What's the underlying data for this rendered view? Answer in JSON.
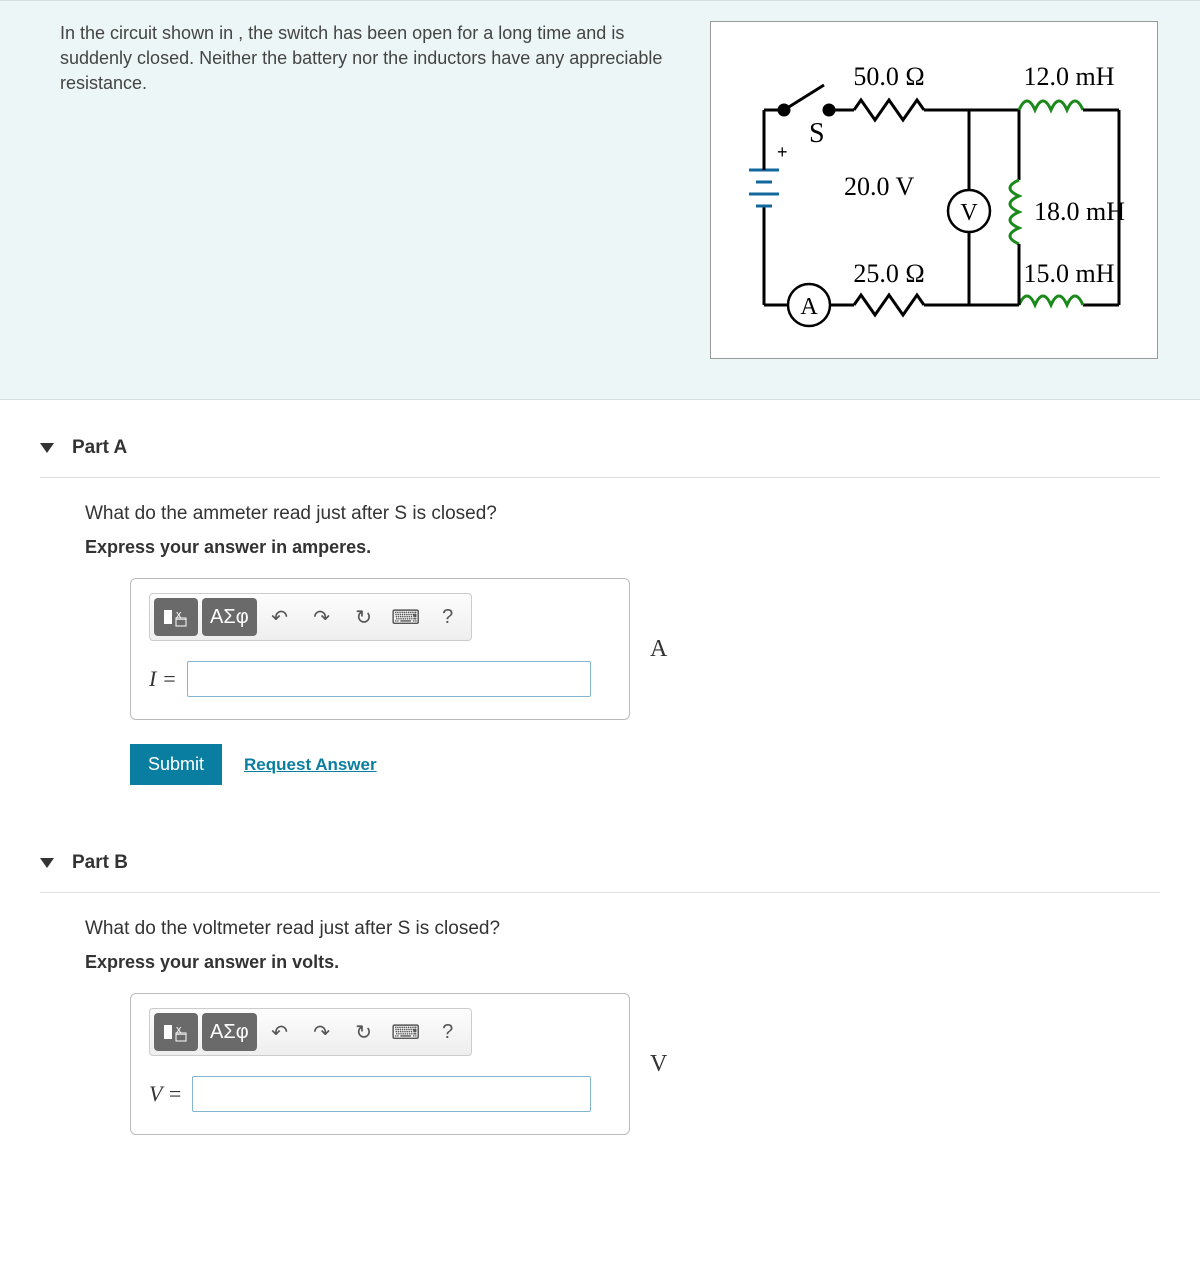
{
  "intro": "In the circuit shown in , the switch has been open for a long time and is suddenly closed. Neither the battery nor the inductors have any appreciable resistance.",
  "circuit": {
    "R1": "50.0 Ω",
    "L1": "12.0 mH",
    "S": "S",
    "Vsrc": "20.0 V",
    "Vmeter": "V",
    "L2": "18.0 mH",
    "R2": "25.0 Ω",
    "L3": "15.0 mH",
    "Ammeter": "A"
  },
  "partA": {
    "title": "Part A",
    "question": "What do the ammeter read just after S is closed?",
    "instruction": "Express your answer in amperes.",
    "var": "I =",
    "unit": "A",
    "value": ""
  },
  "partB": {
    "title": "Part B",
    "question": "What do the voltmeter read just after S is closed?",
    "instruction": "Express your answer in volts.",
    "var": "V =",
    "unit": "V",
    "value": ""
  },
  "toolbar": {
    "templates": "▮",
    "greek": "ΑΣφ",
    "undo": "↶",
    "redo": "↷",
    "reset": "↻",
    "keyboard": "⌨",
    "help": "?"
  },
  "buttons": {
    "submit": "Submit",
    "request": "Request Answer"
  }
}
